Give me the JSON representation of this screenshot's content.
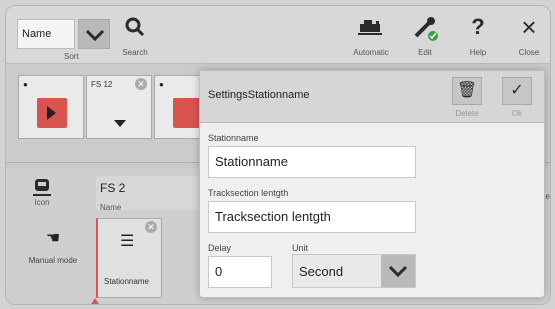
{
  "toolbar": {
    "sort_value": "Name",
    "sort_label": "Sort",
    "search_label": "Search",
    "automatic_label": "Automatic",
    "edit_label": "Edit",
    "help_label": "Help",
    "close_label": "Close",
    "help_glyph": "?",
    "close_glyph": "×",
    "accent_green": "#3a9e3a"
  },
  "cards": [
    {
      "name": ""
    },
    {
      "name": "FS 12"
    },
    {
      "name": ""
    }
  ],
  "panel": {
    "icon_label": "Icon",
    "name_value": "FS 2",
    "name_label": "Name",
    "manual_label": "Manual mode",
    "station_label": "Stationname",
    "right_edge_text": "se"
  },
  "modal": {
    "title": "SettingsStationname",
    "delete_label": "Delete",
    "ok_label": "Ok",
    "stationname_label": "Stationname",
    "stationname_value": "Stationname",
    "tracksection_label": "Tracksection lentgth",
    "tracksection_value": "Tracksection lentgth",
    "delay_label": "Delay",
    "delay_value": "0",
    "unit_label": "Unit",
    "unit_value": "Second"
  },
  "colors": {
    "accent_red": "#d9534f",
    "panel_grey": "#cfcfcf"
  }
}
